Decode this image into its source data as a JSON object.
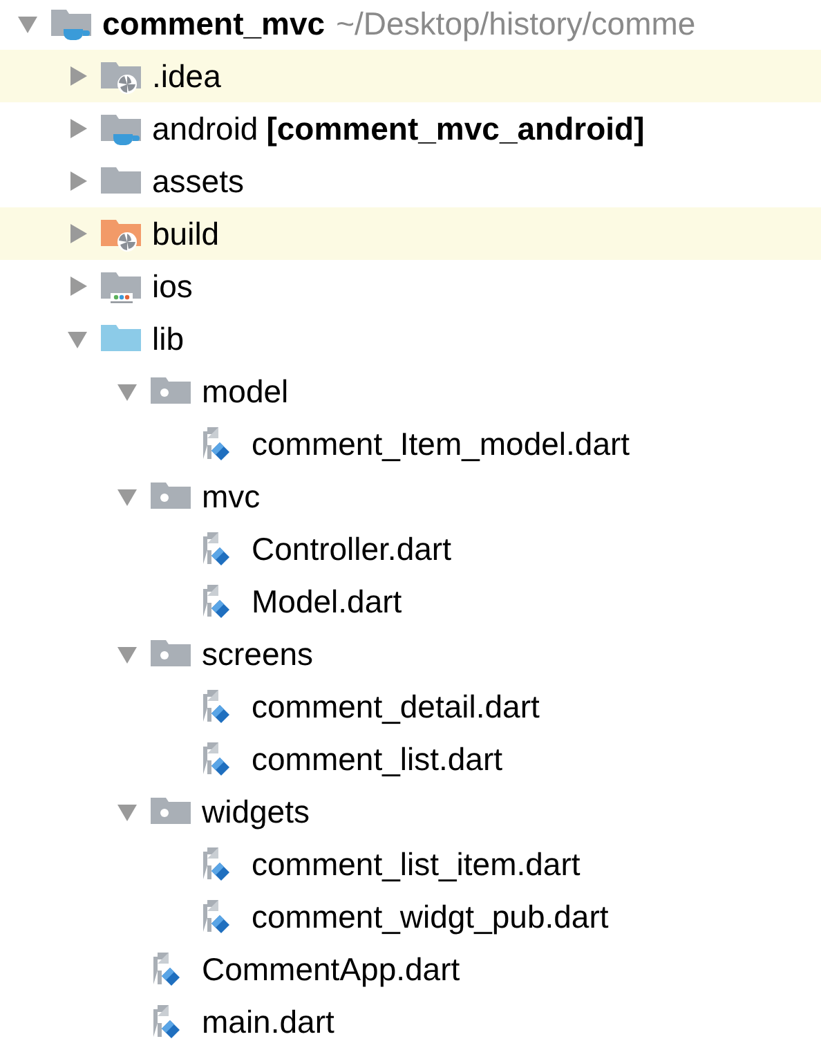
{
  "tree": [
    {
      "name": "comment_mvc",
      "kind": "module",
      "expanded": true,
      "highlighted": false,
      "suffix": {
        "text": "~/Desktop/history/comme",
        "kind": "path"
      },
      "children": [
        {
          "name": ".idea",
          "kind": "idea",
          "expanded": false,
          "highlighted": true
        },
        {
          "name": "android",
          "kind": "module",
          "expanded": false,
          "highlighted": false,
          "suffix": {
            "text": "[comment_mvc_android]",
            "kind": "module"
          }
        },
        {
          "name": "assets",
          "kind": "folder",
          "expanded": false,
          "highlighted": false
        },
        {
          "name": "build",
          "kind": "excluded",
          "expanded": false,
          "highlighted": true
        },
        {
          "name": "ios",
          "kind": "ios",
          "expanded": false,
          "highlighted": false
        },
        {
          "name": "lib",
          "kind": "source",
          "expanded": true,
          "highlighted": false,
          "children": [
            {
              "name": "model",
              "kind": "package",
              "expanded": true,
              "highlighted": false,
              "children": [
                {
                  "name": "comment_Item_model.dart",
                  "kind": "dart",
                  "highlighted": false
                }
              ]
            },
            {
              "name": "mvc",
              "kind": "package",
              "expanded": true,
              "highlighted": false,
              "children": [
                {
                  "name": "Controller.dart",
                  "kind": "dart",
                  "highlighted": false
                },
                {
                  "name": "Model.dart",
                  "kind": "dart",
                  "highlighted": false
                }
              ]
            },
            {
              "name": "screens",
              "kind": "package",
              "expanded": true,
              "highlighted": false,
              "children": [
                {
                  "name": "comment_detail.dart",
                  "kind": "dart",
                  "highlighted": false
                },
                {
                  "name": "comment_list.dart",
                  "kind": "dart",
                  "highlighted": false
                }
              ]
            },
            {
              "name": "widgets",
              "kind": "package",
              "expanded": true,
              "highlighted": false,
              "children": [
                {
                  "name": "comment_list_item.dart",
                  "kind": "dart",
                  "highlighted": false
                },
                {
                  "name": "comment_widgt_pub.dart",
                  "kind": "dart",
                  "highlighted": false
                }
              ]
            },
            {
              "name": "CommentApp.dart",
              "kind": "dart",
              "highlighted": false
            },
            {
              "name": "main.dart",
              "kind": "dart",
              "highlighted": false
            }
          ]
        }
      ]
    }
  ]
}
